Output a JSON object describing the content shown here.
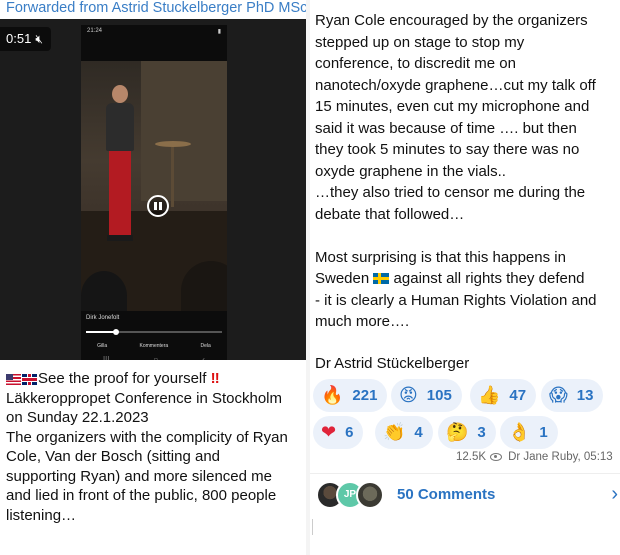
{
  "forwarded": "Forwarded from Astrid Stuckelberger PhD MSc",
  "video": {
    "timer": "0:51",
    "phone_status_time": "21:24",
    "overlay_name": "Dirk Jonefolt",
    "progress_fraction": 0.22,
    "actions": [
      "Gilla",
      "Kommentera",
      "Dela"
    ]
  },
  "left_text": {
    "line1": "See the proof for yourself",
    "line2": "Läkkeroppropet Conference in Stockholm",
    "line3": "on Sunday 22.1.2023",
    "line4": "The organizers with the complicity of Ryan",
    "line5": "Cole, Van der Bosch (sitting and",
    "line6": "supporting Ryan) and more silenced me",
    "line7": "and lied in front of the public, 800 people",
    "line8": "listening…"
  },
  "message": {
    "lines": [
      "Ryan Cole encouraged by the organizers",
      "stepped up on stage to stop my",
      "conference, to discredit me on",
      "nanotech/oxyde graphene…cut my talk off",
      "15 minutes, even cut my microphone and",
      "said it was because of time …. but then",
      "they took 5 minutes to say there was no",
      "oxyde graphene in the vials..",
      "…they also tried to censor me during the",
      "debate that followed…"
    ],
    "lines2_a": "Most surprising is that this happens in",
    "lines2_b_pre": "Sweden",
    "lines2_b_post": " against all rights they defend",
    "lines2_c": "- it is clearly a Human Rights Violation and",
    "lines2_d": "much more…."
  },
  "author": "Dr Astrid Stückelberger",
  "reactions": [
    {
      "emoji": "🔥",
      "count": "221"
    },
    {
      "emoji": "😡",
      "count": "105"
    },
    {
      "emoji": "👍",
      "count": "47"
    },
    {
      "emoji": "😱",
      "count": "13"
    },
    {
      "emoji": "❤",
      "count": "6"
    },
    {
      "emoji": "👏",
      "count": "4"
    },
    {
      "emoji": "🤔",
      "count": "3"
    },
    {
      "emoji": "👌",
      "count": "1"
    }
  ],
  "meta": {
    "views": "12.5K",
    "by_time": "Dr Jane Ruby, 05:13"
  },
  "comments": {
    "avatar_initials": "JP",
    "label": "50 Comments"
  }
}
